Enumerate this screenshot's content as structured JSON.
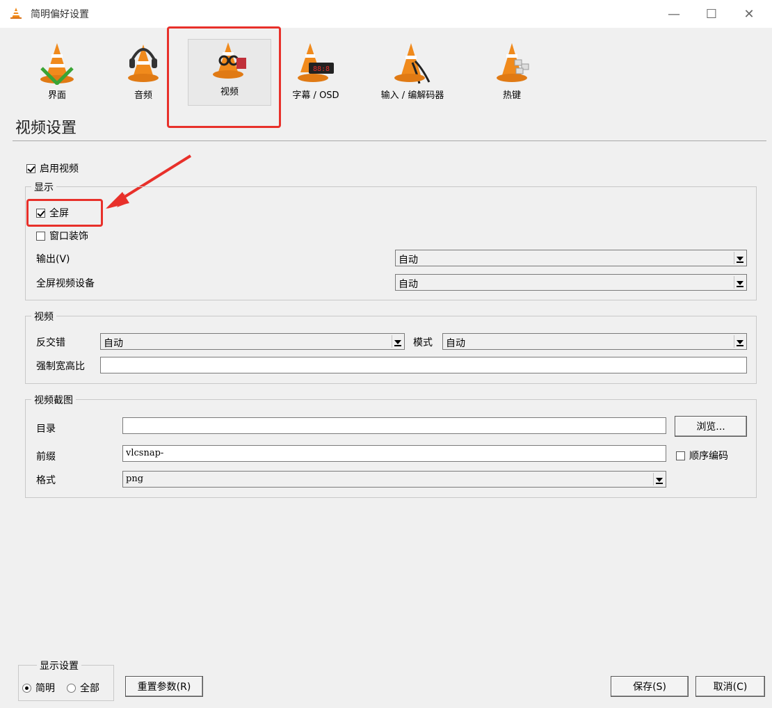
{
  "window": {
    "title": "简明偏好设置",
    "minimize": "—",
    "maximize": "☐",
    "close": "✕"
  },
  "toolbar": [
    {
      "label": "界面"
    },
    {
      "label": "音频"
    },
    {
      "label": "视频"
    },
    {
      "label": "字幕 / OSD"
    },
    {
      "label": "输入 / 编解码器"
    },
    {
      "label": "热键"
    }
  ],
  "section_title": "视频设置",
  "enable_video": {
    "label": "启用视频",
    "checked": true
  },
  "display": {
    "legend": "显示",
    "fullscreen": {
      "label": "全屏",
      "checked": true
    },
    "window_decorations": {
      "label": "窗口装饰",
      "checked": false
    },
    "output_label": "输出(V)",
    "output_value": "自动",
    "fs_device_label": "全屏视频设备",
    "fs_device_value": "自动"
  },
  "video": {
    "legend": "视频",
    "deinterlace_label": "反交错",
    "deinterlace_value": "自动",
    "mode_label": "模式",
    "mode_value": "自动",
    "aspect_label": "强制宽高比",
    "aspect_value": ""
  },
  "snapshot": {
    "legend": "视频截图",
    "dir_label": "目录",
    "dir_value": "",
    "browse": "浏览...",
    "prefix_label": "前缀",
    "prefix_value": "vlcsnap-",
    "sequential": {
      "label": "顺序编码",
      "checked": false
    },
    "format_label": "格式",
    "format_value": "png"
  },
  "show_settings": {
    "legend": "显示设置",
    "simple": {
      "label": "简明",
      "checked": true
    },
    "all": {
      "label": "全部",
      "checked": false
    }
  },
  "buttons": {
    "reset": "重置参数(R)",
    "save": "保存(S)",
    "cancel": "取消(C)"
  },
  "colors": {
    "highlight": "#e8302a",
    "cone_orange": "#f08a1c"
  }
}
